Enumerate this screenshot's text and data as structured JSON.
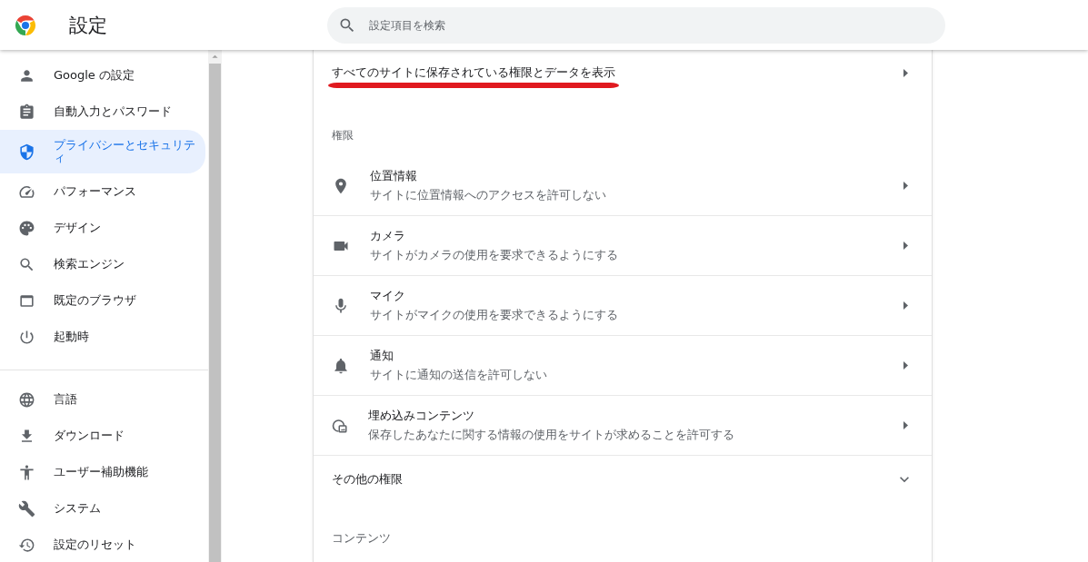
{
  "header": {
    "title": "設定",
    "search": {
      "placeholder": "設定項目を検索"
    }
  },
  "sidebar": {
    "groups": [
      {
        "items": [
          {
            "label": "Google の設定",
            "selected": false
          },
          {
            "label": "自動入力とパスワード",
            "selected": false
          },
          {
            "label": "プライバシーとセキュリティ",
            "selected": true
          },
          {
            "label": "パフォーマンス",
            "selected": false
          },
          {
            "label": "デザイン",
            "selected": false
          },
          {
            "label": "検索エンジン",
            "selected": false
          },
          {
            "label": "既定のブラウザ",
            "selected": false
          },
          {
            "label": "起動時",
            "selected": false
          }
        ]
      },
      {
        "items": [
          {
            "label": "言語",
            "selected": false
          },
          {
            "label": "ダウンロード",
            "selected": false
          },
          {
            "label": "ユーザー補助機能",
            "selected": false
          },
          {
            "label": "システム",
            "selected": false
          },
          {
            "label": "設定のリセット",
            "selected": false
          }
        ]
      }
    ]
  },
  "main": {
    "site_data_link": {
      "label": "すべてのサイトに保存されている権限とデータを表示",
      "underlined": true
    },
    "permissions_heading": "権限",
    "permissions": [
      {
        "title": "位置情報",
        "description": "サイトに位置情報へのアクセスを許可しない"
      },
      {
        "title": "カメラ",
        "description": "サイトがカメラの使用を要求できるようにする"
      },
      {
        "title": "マイク",
        "description": "サイトがマイクの使用を要求できるようにする"
      },
      {
        "title": "通知",
        "description": "サイトに通知の送信を許可しない"
      },
      {
        "title": "埋め込みコンテンツ",
        "description": "保存したあなたに関する情報の使用をサイトが求めることを許可する"
      }
    ],
    "more_permissions": {
      "label": "その他の権限",
      "expanded": false
    },
    "content_heading": "コンテンツ"
  }
}
